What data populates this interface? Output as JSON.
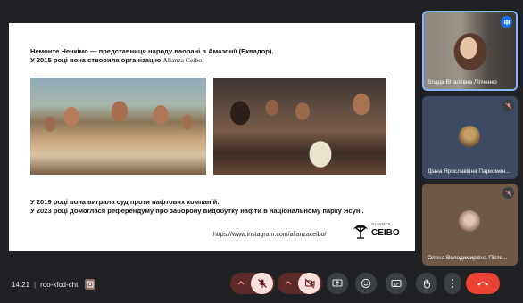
{
  "slide": {
    "top_line1": "Немонте Ненкімо — представниця народу ваорані в Амазонії (Еквадор).",
    "top_line2_pre": "У 2015 році вона створила організацію ",
    "top_line2_org": "Alianza Ceibo.",
    "bottom_line1": "У 2019 році вона виграла суд проти нафтових компаній.",
    "bottom_line2": "У 2023 році домоглася референдуму про заборону видобутку нафти в національному парку Ясуні.",
    "url": "https://www.instagram.com/alianzaceibo/",
    "logo_small": "ALIANZA",
    "logo_big": "CEIBO"
  },
  "participants": [
    {
      "name": "Влада Віталіївна Ліпченко",
      "muted": false,
      "speaking": true
    },
    {
      "name": "Діана Ярославівна Паркомен...",
      "muted": true
    },
    {
      "name": "Олена Володимирівна Пісте...",
      "muted": true
    }
  ],
  "meeting": {
    "time": "14:21",
    "separator": "|",
    "code": "roo-kfcd-cht"
  },
  "colors": {
    "accent": "#8ab4f8",
    "end_call": "#ea4335",
    "muted_control": "#5c2b29"
  },
  "icons": [
    "menu-icon",
    "mic-off-icon",
    "camera-off-icon",
    "chevron-up-icon",
    "present-icon",
    "emoji-icon",
    "captions-icon",
    "raise-hand-icon",
    "more-icon",
    "end-call-icon",
    "audio-bars-icon"
  ]
}
